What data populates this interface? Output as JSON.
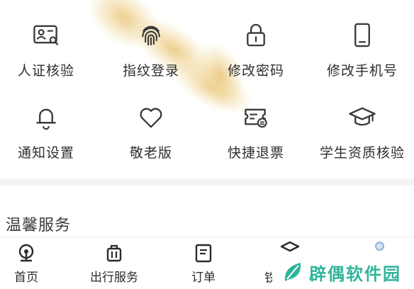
{
  "features": {
    "row1": [
      {
        "icon": "id-card-search-icon",
        "label": "人证核验"
      },
      {
        "icon": "fingerprint-icon",
        "label": "指纹登录"
      },
      {
        "icon": "lock-icon",
        "label": "修改密码"
      },
      {
        "icon": "mobile-phone-icon",
        "label": "修改手机号"
      }
    ],
    "row2": [
      {
        "icon": "bell-icon",
        "label": "通知设置"
      },
      {
        "icon": "heart-icon",
        "label": "敬老版"
      },
      {
        "icon": "ticket-refund-icon",
        "label": "快捷退票"
      },
      {
        "icon": "graduation-cap-icon",
        "label": "学生资质核验"
      }
    ]
  },
  "warm_services": {
    "title": "温馨服务"
  },
  "tabbar": {
    "items": [
      {
        "icon": "home-train-icon",
        "label": "首页"
      },
      {
        "icon": "luggage-icon",
        "label": "出行服务"
      },
      {
        "icon": "order-list-icon",
        "label": "订单"
      },
      {
        "icon": "partial-tab-icon",
        "label": "铁"
      }
    ]
  },
  "watermark": {
    "text": "辟偶软件园",
    "color": "#2fb59a"
  },
  "colors": {
    "icon": "#3a3a3a",
    "accent": "#2fb59a",
    "streak": "#e8c478"
  }
}
